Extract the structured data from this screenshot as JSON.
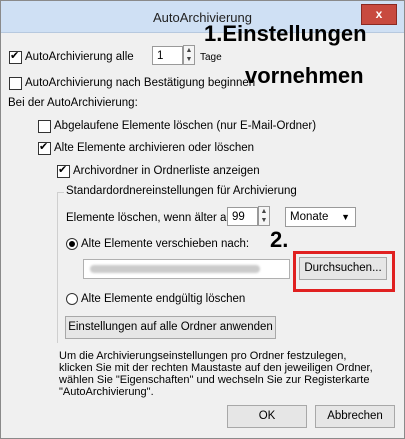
{
  "window": {
    "title": "AutoArchivierung",
    "close_glyph": "x"
  },
  "annotations": {
    "step1_line1": "1.Einstellungen",
    "step1_line2": "vornehmen",
    "step2": "2."
  },
  "autoarchive_every": {
    "label": "AutoArchivierung alle",
    "value": "1",
    "unit": "Tage"
  },
  "confirm_before": {
    "label": "AutoArchivierung nach Bestätigung beginnen"
  },
  "during_label": "Bei der AutoArchivierung:",
  "delete_expired": {
    "label": "Abgelaufene Elemente löschen (nur E-Mail-Ordner)"
  },
  "archive_old": {
    "label": "Alte Elemente archivieren oder löschen"
  },
  "show_folder": {
    "label": "Archivordner in Ordnerliste anzeigen"
  },
  "default_group": {
    "title": "Standardordnereinstellungen für Archivierung"
  },
  "delete_older": {
    "label": "Elemente löschen, wenn älter als",
    "value": "99",
    "unit": "Monate"
  },
  "move_old": {
    "label": "Alte Elemente verschieben nach:",
    "browse": "Durchsuchen..."
  },
  "perm_delete": {
    "label": "Alte Elemente endgültig löschen"
  },
  "apply_all": "Einstellungen auf alle Ordner anwenden",
  "note": "Um die Archivierungseinstellungen pro Ordner festzulegen, klicken Sie mit der rechten Maustaste auf den jeweiligen Ordner, wählen Sie \"Eigenschaften\" und wechseln Sie zur Registerkarte \"AutoArchivierung\".",
  "buttons": {
    "ok": "OK",
    "cancel": "Abbrechen"
  },
  "colors": {
    "titlebar": "#cfe0f4",
    "close": "#c84a3f",
    "highlight": "#e02020"
  }
}
